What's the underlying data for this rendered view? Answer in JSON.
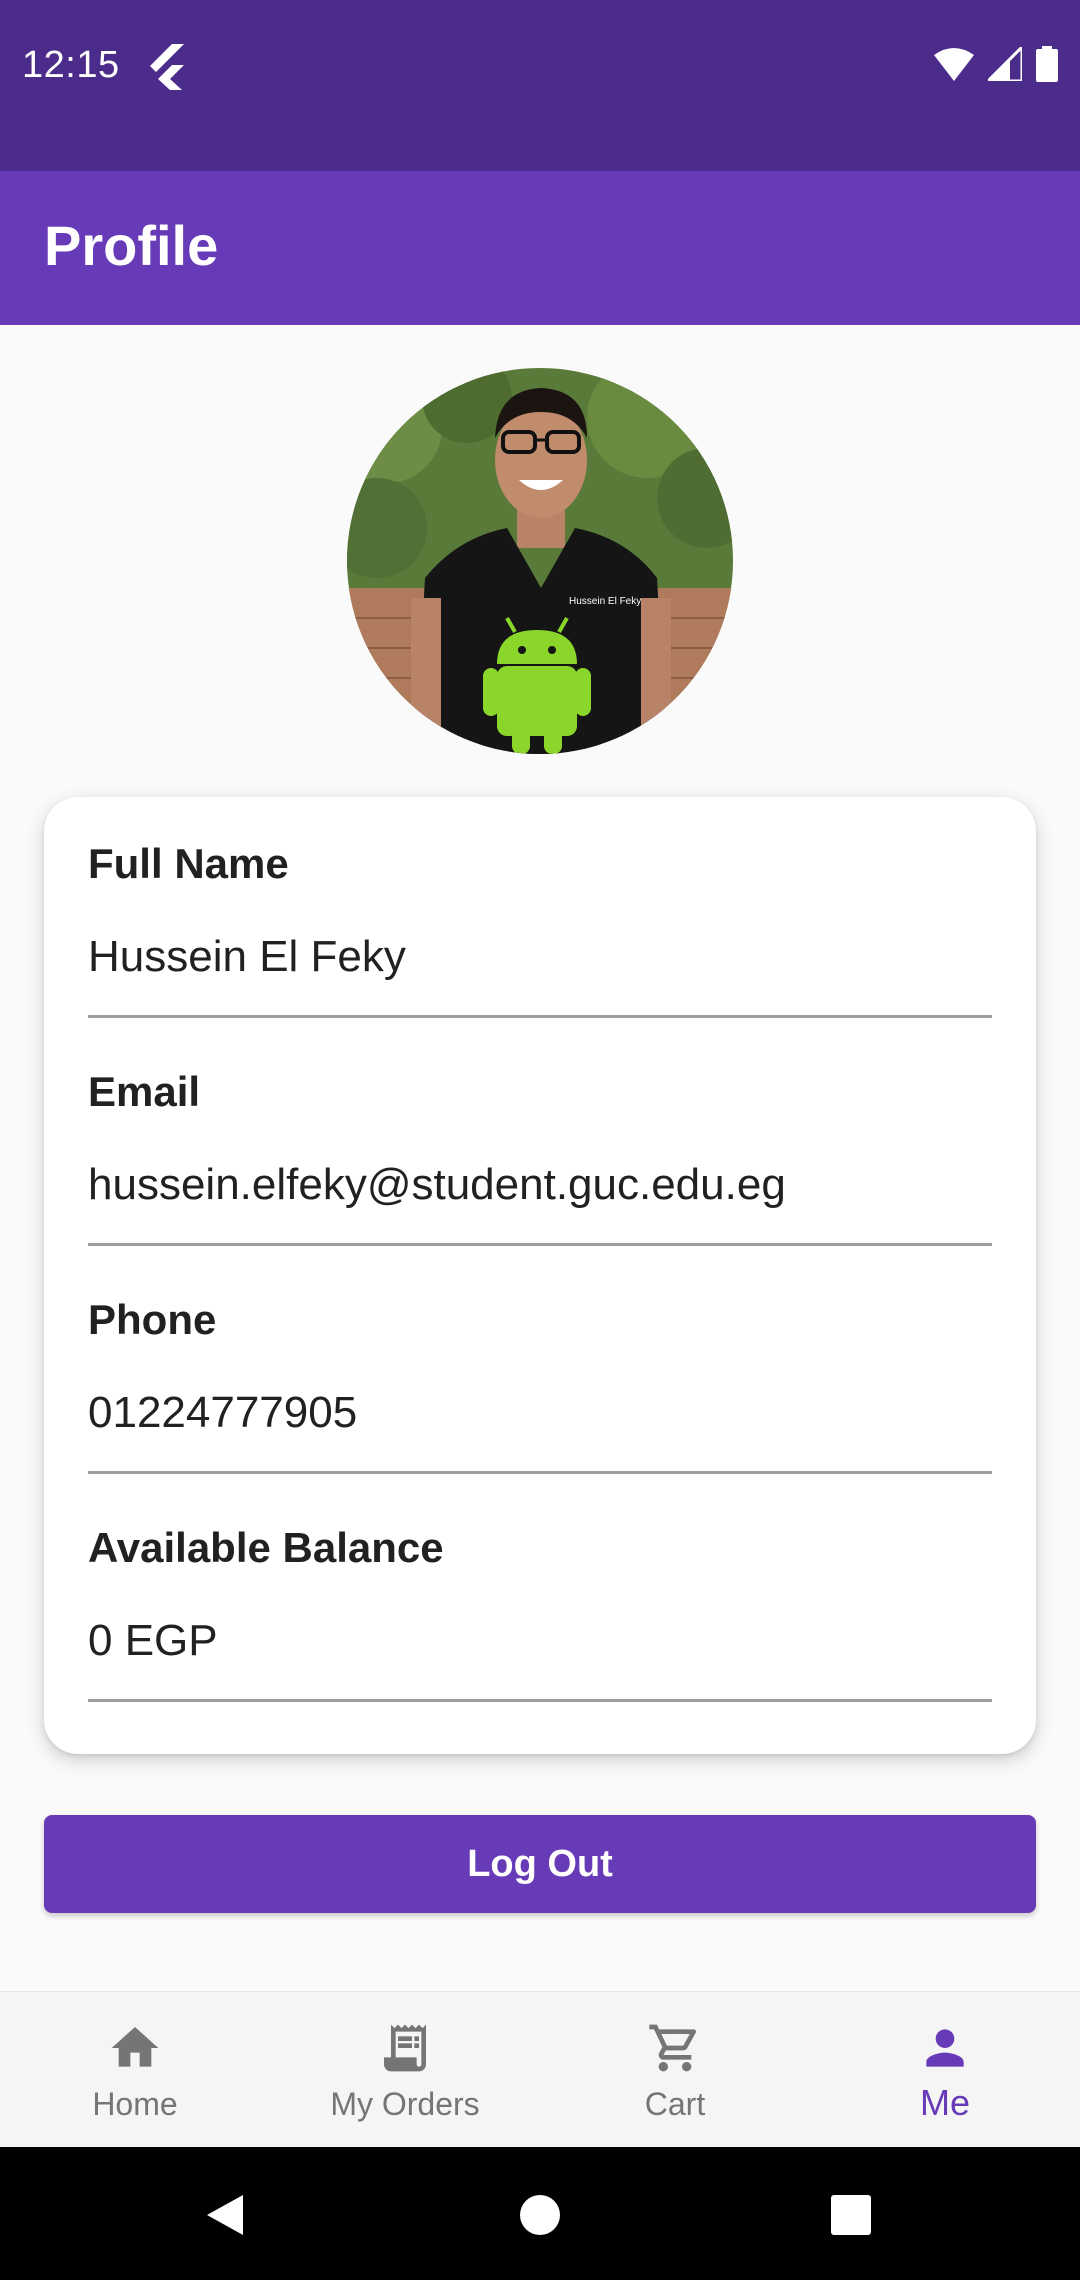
{
  "status_bar": {
    "time": "12:15"
  },
  "app_bar": {
    "title": "Profile"
  },
  "profile": {
    "fields": [
      {
        "label": "Full Name",
        "value": "Hussein El Feky"
      },
      {
        "label": "Email",
        "value": "hussein.elfeky@student.guc.edu.eg"
      },
      {
        "label": "Phone",
        "value": "01224777905"
      },
      {
        "label": "Available Balance",
        "value": "0 EGP"
      }
    ],
    "shirt_text": "Hussein El Feky"
  },
  "logout_label": "Log Out",
  "bottom_nav": {
    "items": [
      {
        "label": "Home",
        "icon": "home-icon"
      },
      {
        "label": "My Orders",
        "icon": "receipt-icon"
      },
      {
        "label": "Cart",
        "icon": "cart-icon"
      },
      {
        "label": "Me",
        "icon": "person-icon"
      }
    ],
    "active": "Me"
  },
  "colors": {
    "status_bar": "#4c2c8a",
    "primary": "#673ab7",
    "inactive": "#757575"
  }
}
